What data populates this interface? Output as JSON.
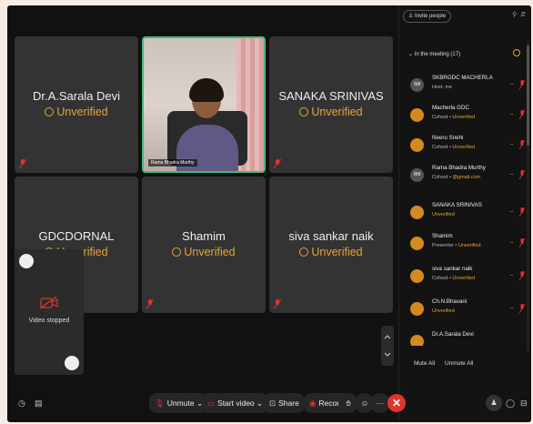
{
  "tiles": {
    "sarala": {
      "name": "Dr.A.Sarala Devi",
      "status": "Unverified"
    },
    "sanaka": {
      "name": "SANAKA SRINIVAS",
      "status": "Unverified"
    },
    "gdc": {
      "name": "GDCDORNAL",
      "status": "Unverified"
    },
    "shamim": {
      "name": "Shamim",
      "status": "Unverified"
    },
    "siva": {
      "name": "siva sankar naik",
      "status": "Unverified"
    },
    "video_label": "Rama Bhadra Murthy",
    "self_status": "Video stopped"
  },
  "panel": {
    "invite_label": "Invite people",
    "section_label": "In the meeting (17)",
    "participants": [
      {
        "initials": "SM",
        "name": "SKBRGDC MACHERLA",
        "role": "Host, me",
        "status": ""
      },
      {
        "initials": "",
        "name": "Macherla GDC",
        "role": "Cohost",
        "status": "Unverified"
      },
      {
        "initials": "",
        "name": "Neeru Snehi",
        "role": "Cohost",
        "status": "Unverified"
      },
      {
        "initials": "RM",
        "name": "Rama Bhadra Murthy",
        "role": "Cohost",
        "status": "@gmail.com"
      },
      {
        "initials": "",
        "name": "SANAKA SRINIVAS",
        "role": "",
        "status": "Unverified"
      },
      {
        "initials": "",
        "name": "Shamim",
        "role": "Presenter",
        "status": "Unverified"
      },
      {
        "initials": "",
        "name": "siva sankar naik",
        "role": "Cohost",
        "status": "Unverified"
      },
      {
        "initials": "",
        "name": "Ch.N.Bhavani",
        "role": "",
        "status": "Unverified"
      },
      {
        "initials": "",
        "name": "Dr.A.Sarala Devi",
        "role": "",
        "status": ""
      }
    ],
    "mute_all": "Mute All",
    "unmute_all": "Unmute All"
  },
  "toolbar": {
    "unmute": "Unmute",
    "start_video": "Start video",
    "share": "Share",
    "record": "Record",
    "more": "···"
  },
  "colors": {
    "accent": "#e7a33a",
    "leave": "#e0342f",
    "active_border": "#48b87e"
  }
}
